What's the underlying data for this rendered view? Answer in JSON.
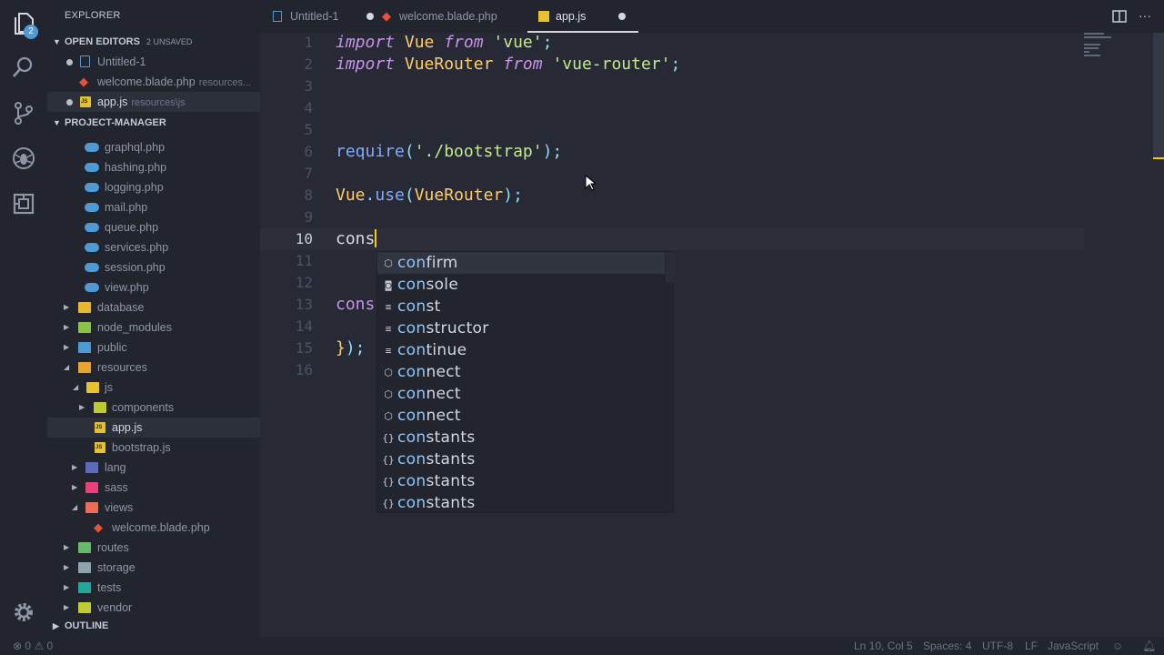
{
  "activity_bar": {
    "items": [
      {
        "name": "explorer-icon",
        "active": true,
        "badge": "2"
      },
      {
        "name": "search-icon"
      },
      {
        "name": "source-control-icon"
      },
      {
        "name": "debug-icon"
      },
      {
        "name": "extensions-icon"
      }
    ],
    "manage_icon": "gear-icon"
  },
  "sidebar": {
    "title": "EXPLORER",
    "open_editors": {
      "label": "OPEN EDITORS",
      "badge": "2 UNSAVED",
      "items": [
        {
          "name": "Untitled-1",
          "path": "",
          "dirty": true
        },
        {
          "name": "welcome.blade.php",
          "path": "resources...",
          "dirty": false
        },
        {
          "name": "app.js",
          "path": "resources\\js",
          "dirty": true
        }
      ]
    },
    "project": {
      "label": "PROJECT-MANAGER",
      "items": [
        {
          "name": "graphql.php"
        },
        {
          "name": "hashing.php"
        },
        {
          "name": "logging.php"
        },
        {
          "name": "mail.php"
        },
        {
          "name": "queue.php"
        },
        {
          "name": "services.php"
        },
        {
          "name": "session.php"
        },
        {
          "name": "view.php"
        },
        {
          "name": "database"
        },
        {
          "name": "node_modules"
        },
        {
          "name": "public"
        },
        {
          "name": "resources"
        },
        {
          "name": "js"
        },
        {
          "name": "components"
        },
        {
          "name": "app.js"
        },
        {
          "name": "bootstrap.js"
        },
        {
          "name": "lang"
        },
        {
          "name": "sass"
        },
        {
          "name": "views"
        },
        {
          "name": "welcome.blade.php"
        },
        {
          "name": "routes"
        },
        {
          "name": "storage"
        },
        {
          "name": "tests"
        },
        {
          "name": "vendor"
        }
      ]
    },
    "outline_label": "OUTLINE"
  },
  "tabs": [
    {
      "label": "Untitled-1",
      "dirty": true,
      "active": false
    },
    {
      "label": "welcome.blade.php",
      "dirty": false,
      "active": false
    },
    {
      "label": "app.js",
      "dirty": true,
      "active": true
    }
  ],
  "editor": {
    "line_numbers": [
      "1",
      "2",
      "3",
      "4",
      "5",
      "6",
      "7",
      "8",
      "9",
      "10",
      "11",
      "12",
      "13",
      "14",
      "15",
      "16"
    ],
    "active_line": "10",
    "code": {
      "l1_kw": "import",
      "l1_id": " Vue ",
      "l1_from": "from",
      "l1_str": " 'vue'",
      "l1_end": ";",
      "l2_kw": "import",
      "l2_id": " VueRouter ",
      "l2_from": "from",
      "l2_str": " 'vue-router'",
      "l2_end": ";",
      "l6_fn": "require",
      "l6_p1": "(",
      "l6_str": "'./bootstrap'",
      "l6_p2": ");",
      "l8_obj": "Vue",
      "l8_dot": ".",
      "l8_fn": "use",
      "l8_p1": "(",
      "l8_arg": "VueRouter",
      "l8_p2": ");",
      "l10_typed": "cons",
      "l13": "cons",
      "l15_brace": "}",
      "l15_rest": ");"
    }
  },
  "suggest": {
    "typed": "con",
    "items": [
      {
        "icon": "method-icon",
        "glyph": "⬡",
        "match": "con",
        "rest": "firm",
        "selected": true
      },
      {
        "icon": "variable-icon",
        "glyph": "◙",
        "match": "con",
        "rest": "sole"
      },
      {
        "icon": "keyword-icon",
        "glyph": "≡",
        "match": "con",
        "rest": "st"
      },
      {
        "icon": "keyword-icon",
        "glyph": "≡",
        "match": "con",
        "rest": "structor"
      },
      {
        "icon": "keyword-icon",
        "glyph": "≡",
        "match": "con",
        "rest": "tinue"
      },
      {
        "icon": "method-icon",
        "glyph": "⬡",
        "match": "con",
        "rest": "nect"
      },
      {
        "icon": "method-icon",
        "glyph": "⬡",
        "match": "con",
        "rest": "nect"
      },
      {
        "icon": "method-icon",
        "glyph": "⬡",
        "match": "con",
        "rest": "nect"
      },
      {
        "icon": "module-icon",
        "glyph": "{}",
        "match": "con",
        "rest": "stants"
      },
      {
        "icon": "module-icon",
        "glyph": "{}",
        "match": "con",
        "rest": "stants"
      },
      {
        "icon": "module-icon",
        "glyph": "{}",
        "match": "con",
        "rest": "stants"
      },
      {
        "icon": "module-icon",
        "glyph": "{}",
        "match": "con",
        "rest": "stants"
      }
    ]
  },
  "statusbar": {
    "errors": "0",
    "warnings": "0",
    "position": "Ln 10, Col 5",
    "spaces": "Spaces: 4",
    "encoding": "UTF-8",
    "eol": "LF",
    "language": "JavaScript"
  },
  "colors": {
    "accent": "#4e9ad6",
    "cursor": "#ffcc00",
    "keyword": "#c792ea",
    "string": "#c3e88d",
    "function": "#82aaff"
  }
}
